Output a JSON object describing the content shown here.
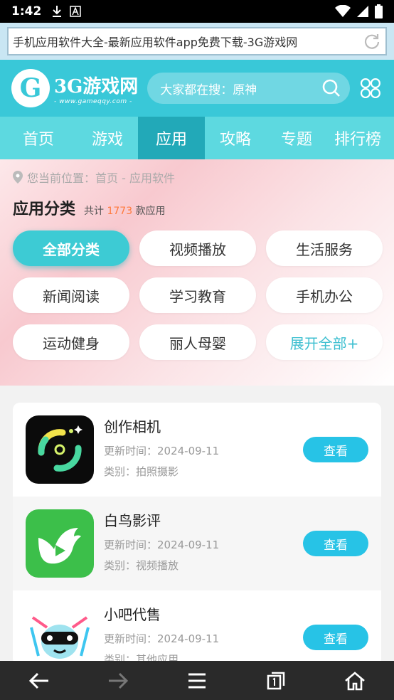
{
  "status": {
    "time": "1:42"
  },
  "browser": {
    "url_title": "手机应用软件大全-最新应用软件app免费下载-3G游戏网"
  },
  "site": {
    "logo_text": "3G游戏网",
    "logo_url": "- www.gameqqy.com -",
    "search_hint": "大家都在搜：原神"
  },
  "nav": {
    "tabs": [
      "首页",
      "游戏",
      "应用",
      "攻略",
      "专题",
      "排行榜"
    ],
    "active": "应用"
  },
  "breadcrumb": "您当前位置：首页 - 应用软件",
  "category": {
    "title": "应用分类",
    "count_prefix": "共计",
    "count": "1773",
    "count_suffix": "款应用",
    "items": [
      "全部分类",
      "视频播放",
      "生活服务",
      "新闻阅读",
      "学习教育",
      "手机办公",
      "运动健身",
      "丽人母婴",
      "展开全部+"
    ]
  },
  "apps": [
    {
      "name": "创作相机",
      "updated": "更新时间：2024-09-11",
      "category": "类别：拍照摄影",
      "button": "查看"
    },
    {
      "name": "白鸟影评",
      "updated": "更新时间：2024-09-11",
      "category": "类别：视频播放",
      "button": "查看"
    },
    {
      "name": "小吧代售",
      "updated": "更新时间：2024-09-11",
      "category": "类别：其他应用",
      "button": "查看"
    }
  ],
  "colors": {
    "accent": "#39c8d8",
    "button": "#27c3e6",
    "count": "#ff7a3d"
  }
}
